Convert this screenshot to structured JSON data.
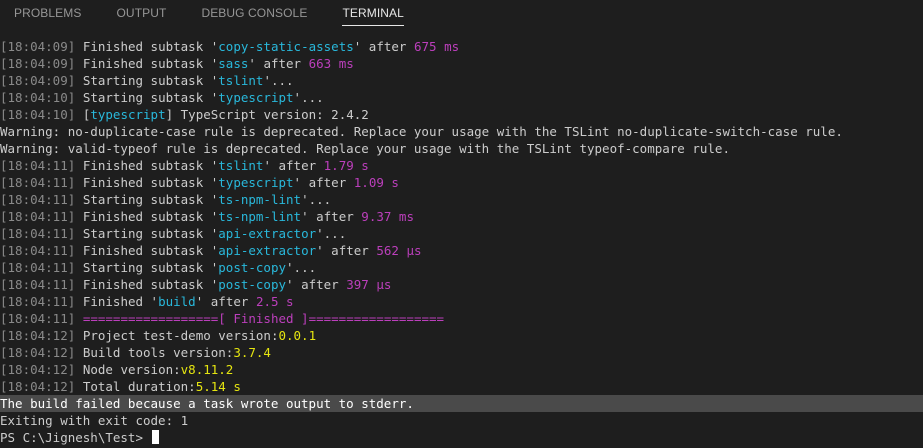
{
  "tabs": [
    {
      "label": "PROBLEMS",
      "active": false
    },
    {
      "label": "OUTPUT",
      "active": false
    },
    {
      "label": "DEBUG CONSOLE",
      "active": false
    },
    {
      "label": "TERMINAL",
      "active": true
    }
  ],
  "colors": {
    "background": "#1e1e1e",
    "timestamp": "#8a8a8a",
    "name": "#29b8db",
    "duration": "#bc3fbc",
    "version": "#e5e510",
    "error_bar": "#4a4a4a"
  },
  "terminal": {
    "lines": [
      {
        "ts": "18:04:09",
        "pre": "Finished subtask '",
        "name": "copy-static-assets",
        "mid": "' after ",
        "dur": "675 ms"
      },
      {
        "ts": "18:04:09",
        "pre": "Finished subtask '",
        "name": "sass",
        "mid": "' after ",
        "dur": "663 ms"
      },
      {
        "ts": "18:04:09",
        "pre": "Starting subtask '",
        "name": "tslint",
        "post": "'..."
      },
      {
        "ts": "18:04:10",
        "pre": "Starting subtask '",
        "name": "typescript",
        "post": "'..."
      },
      {
        "ts": "18:04:10",
        "pre": "[",
        "name": "typescript",
        "post": "] TypeScript version: 2.4.2"
      },
      {
        "plain": "Warning: no-duplicate-case rule is deprecated. Replace your usage with the TSLint no-duplicate-switch-case rule."
      },
      {
        "plain": "Warning: valid-typeof rule is deprecated. Replace your usage with the TSLint typeof-compare rule."
      },
      {
        "ts": "18:04:11",
        "pre": "Finished subtask '",
        "name": "tslint",
        "mid": "' after ",
        "dur": "1.79 s"
      },
      {
        "ts": "18:04:11",
        "pre": "Finished subtask '",
        "name": "typescript",
        "mid": "' after ",
        "dur": "1.09 s"
      },
      {
        "ts": "18:04:11",
        "pre": "Starting subtask '",
        "name": "ts-npm-lint",
        "post": "'..."
      },
      {
        "ts": "18:04:11",
        "pre": "Finished subtask '",
        "name": "ts-npm-lint",
        "mid": "' after ",
        "dur": "9.37 ms"
      },
      {
        "ts": "18:04:11",
        "pre": "Starting subtask '",
        "name": "api-extractor",
        "post": "'..."
      },
      {
        "ts": "18:04:11",
        "pre": "Finished subtask '",
        "name": "api-extractor",
        "mid": "' after ",
        "dur": "562 µs"
      },
      {
        "ts": "18:04:11",
        "pre": "Starting subtask '",
        "name": "post-copy",
        "post": "'..."
      },
      {
        "ts": "18:04:11",
        "pre": "Finished subtask '",
        "name": "post-copy",
        "mid": "' after ",
        "dur": "397 µs"
      },
      {
        "ts": "18:04:11",
        "pre": "Finished '",
        "name": "build",
        "mid": "' after ",
        "dur": "2.5 s"
      },
      {
        "ts": "18:04:11",
        "banner": "==================[ Finished ]=================="
      },
      {
        "ts": "18:04:12",
        "pre": "Project test-demo version:",
        "ver": "0.0.1"
      },
      {
        "ts": "18:04:12",
        "pre": "Build tools version:",
        "ver": "3.7.4"
      },
      {
        "ts": "18:04:12",
        "pre": "Node version:",
        "ver": "v8.11.2"
      },
      {
        "ts": "18:04:12",
        "pre": "Total duration:",
        "ver": "5.14 s"
      },
      {
        "plain": "The build failed because a task wrote output to stderr.",
        "error": true
      },
      {
        "plain": "Exiting with exit code: 1"
      }
    ],
    "prompt": "PS C:\\Jignesh\\Test> "
  }
}
